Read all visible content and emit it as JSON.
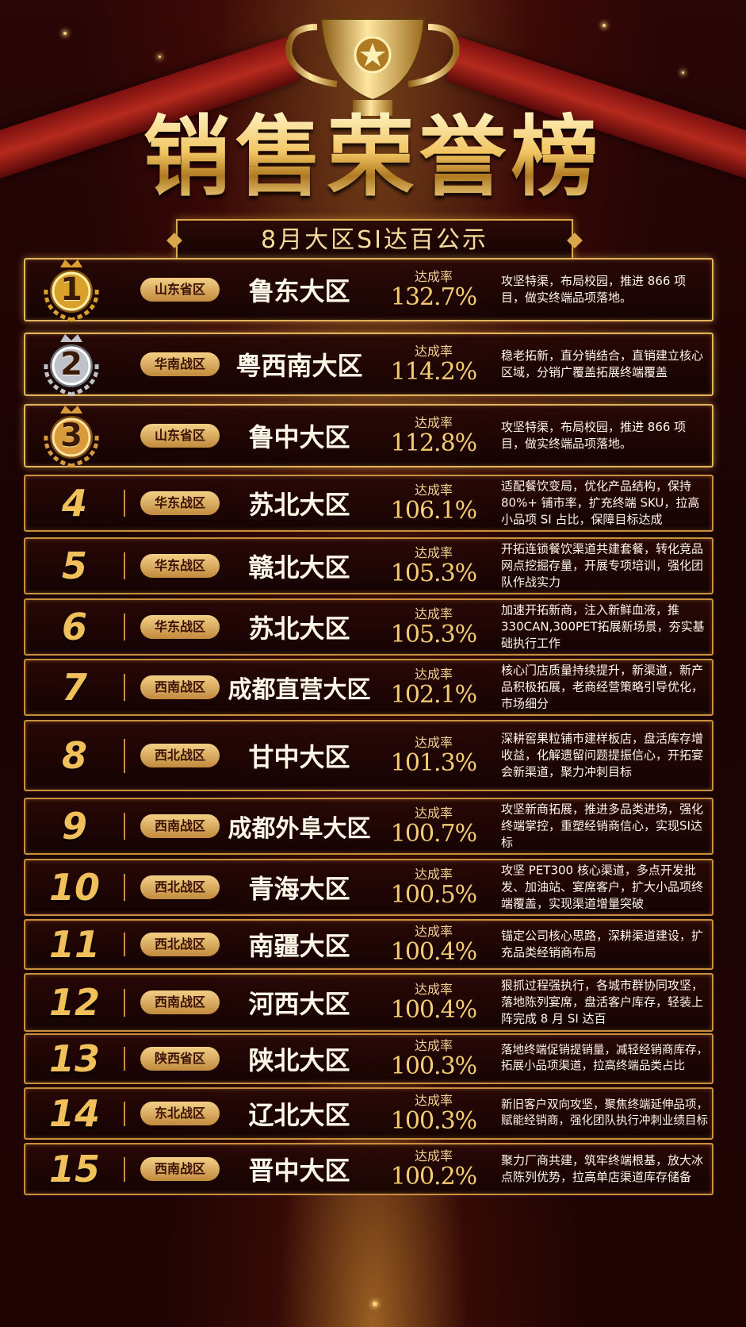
{
  "header": {
    "title": "销售荣誉榜",
    "subtitle": "8月大区SI达百公示"
  },
  "colors": {
    "gold": "#f1c05a",
    "background": "#1a0303",
    "ribbon": "#b52a1d",
    "tag_gold": "#e0ac5f"
  },
  "rate_label": "达成率",
  "rows": [
    {
      "rank": "1",
      "tag": "山东省区",
      "region": "鲁东大区",
      "rate": "132.7%",
      "desc": "攻坚特渠，布局校园，推进 866 项目，做实终端品项落地。",
      "medal": "gold-medal-icon"
    },
    {
      "rank": "2",
      "tag": "华南战区",
      "region": "粤西南大区",
      "rate": "114.2%",
      "desc": "稳老拓新，直分销结合，直销建立核心区域，分销广覆盖拓展终端覆盖",
      "medal": "silver-medal-icon"
    },
    {
      "rank": "3",
      "tag": "山东省区",
      "region": "鲁中大区",
      "rate": "112.8%",
      "desc": "攻坚特渠，布局校园，推进 866 项目，做实终端品项落地。",
      "medal": "bronze-medal-icon"
    },
    {
      "rank": "4",
      "tag": "华东战区",
      "region": "苏北大区",
      "rate": "106.1%",
      "desc": "适配餐饮变局，优化产品结构，保持 80%+ 铺市率，扩充终端 SKU，拉高小品项 SI 占比，保障目标达成"
    },
    {
      "rank": "5",
      "tag": "华东战区",
      "region": "赣北大区",
      "rate": "105.3%",
      "desc": "开拓连锁餐饮渠道共建套餐，转化竞品网点挖掘存量，开展专项培训，强化团队作战实力"
    },
    {
      "rank": "6",
      "tag": "华东战区",
      "region": "苏北大区",
      "rate": "105.3%",
      "desc": "加速开拓新商，注入新鲜血液，推330CAN,300PET拓展新场景，夯实基础执行工作"
    },
    {
      "rank": "7",
      "tag": "西南战区",
      "region": "成都直营大区",
      "rate": "102.1%",
      "desc": "核心门店质量持续提升，新渠道，新产品积极拓展，老商经营策略引导优化，市场细分"
    },
    {
      "rank": "8",
      "tag": "西北战区",
      "region": "甘中大区",
      "rate": "101.3%",
      "desc": "深耕窖果粒铺市建样板店，盘活库存增收益，化解遗留问题提振信心，开拓宴会新渠道，聚力冲刺目标"
    },
    {
      "rank": "9",
      "tag": "西南战区",
      "region": "成都外阜大区",
      "rate": "100.7%",
      "desc": "攻坚新商拓展，推进多品类进场，强化终端掌控，重塑经销商信心，实现SI达标"
    },
    {
      "rank": "10",
      "tag": "西北战区",
      "region": "青海大区",
      "rate": "100.5%",
      "desc": "攻坚 PET300 核心渠道，多点开发批发、加油站、宴席客户，扩大小品项终端覆盖，实现渠道增量突破"
    },
    {
      "rank": "11",
      "tag": "西北战区",
      "region": "南疆大区",
      "rate": "100.4%",
      "desc": "锚定公司核心思路，深耕渠道建设，扩充品类经销商布局"
    },
    {
      "rank": "12",
      "tag": "西南战区",
      "region": "河西大区",
      "rate": "100.4%",
      "desc": "狠抓过程强执行，各城市群协同攻坚，落地陈列宴席，盘活客户库存，轻装上阵完成 8 月 SI 达百"
    },
    {
      "rank": "13",
      "tag": "陕西省区",
      "region": "陕北大区",
      "rate": "100.3%",
      "desc": "落地终端促销提销量，减轻经销商库存，拓展小品项渠道，拉高终端品类占比"
    },
    {
      "rank": "14",
      "tag": "东北战区",
      "region": "辽北大区",
      "rate": "100.3%",
      "desc": "新旧客户双向攻坚，聚焦终端延伸品项，赋能经销商，强化团队执行冲刺业绩目标"
    },
    {
      "rank": "15",
      "tag": "西南战区",
      "region": "晋中大区",
      "rate": "100.2%",
      "desc": "聚力厂商共建，筑牢终端根基，放大冰点陈列优势，拉高单店渠道库存储备"
    }
  ]
}
